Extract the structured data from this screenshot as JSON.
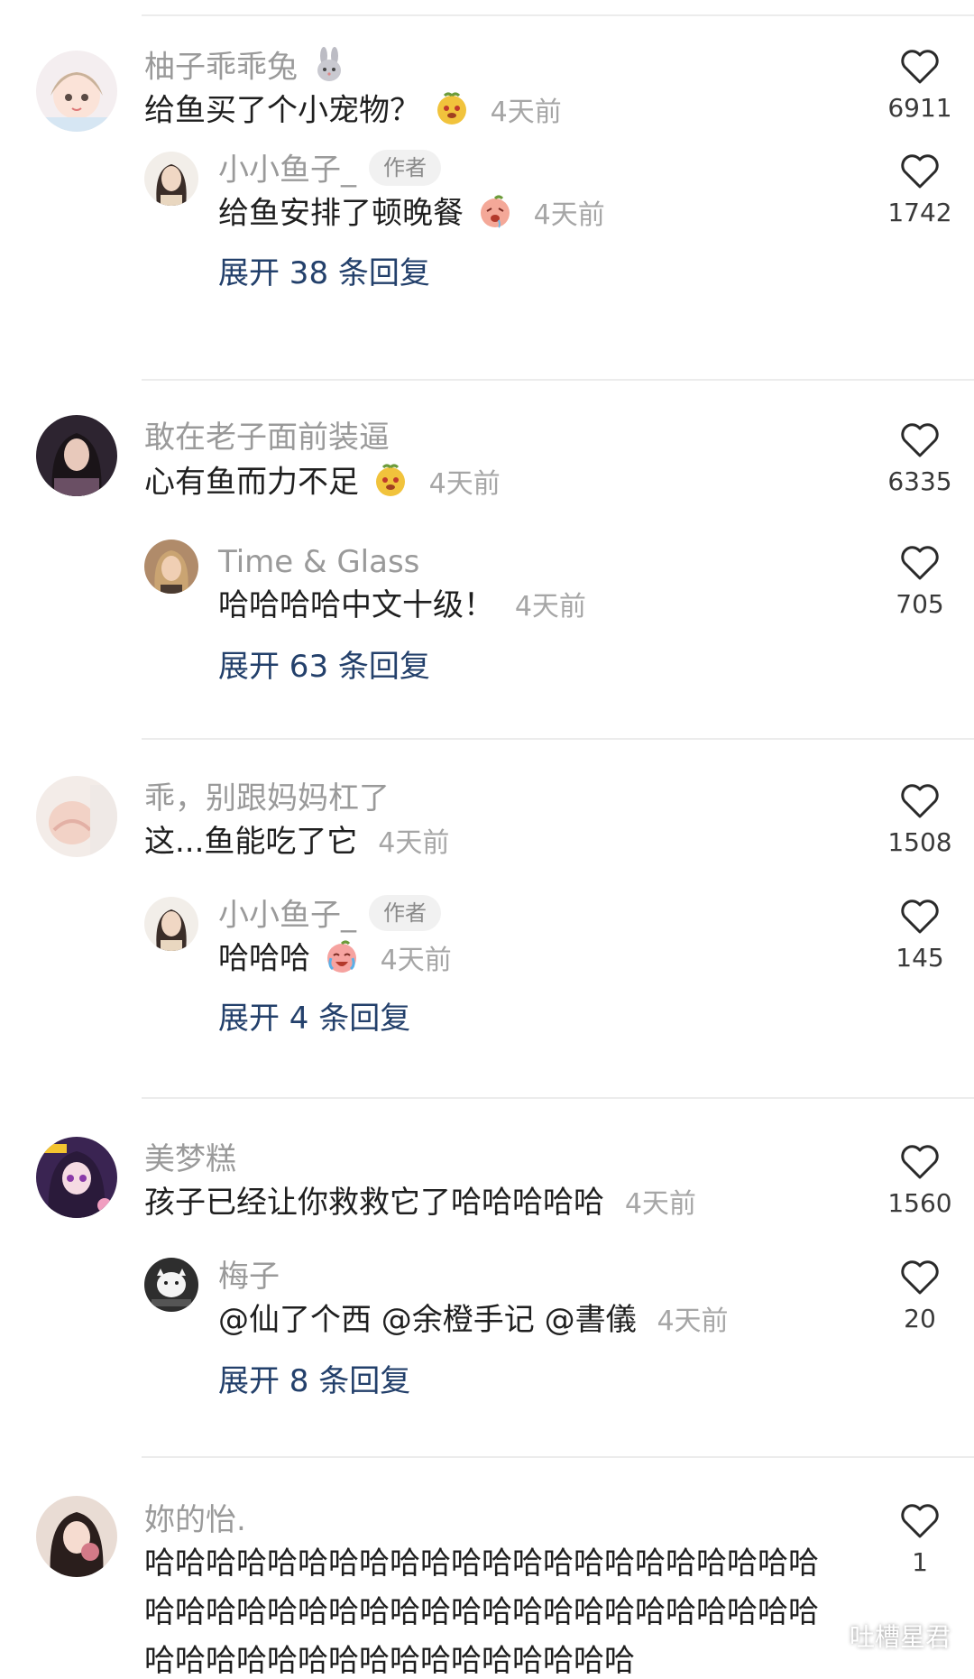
{
  "threads": [
    {
      "comment": {
        "username": "柚子乖乖兔",
        "text": "给鱼买了个小宠物？",
        "time": "4天前",
        "likes": "6911",
        "emoji_icon": "bunny-emoji",
        "text_emoji_icon": "bear-face-emoji"
      },
      "reply": {
        "username": "小小鱼子_",
        "badge": "作者",
        "text": "给鱼安排了顿晚餐",
        "time": "4天前",
        "likes": "1742",
        "text_emoji_icon": "drooling-peach-emoji"
      },
      "expand": "展开 38 条回复"
    },
    {
      "comment": {
        "username": "敢在老子面前装逼",
        "text": "心有鱼而力不足",
        "time": "4天前",
        "likes": "6335",
        "text_emoji_icon": "bear-face-emoji"
      },
      "reply": {
        "username": "Time & Glass",
        "text": "哈哈哈哈中文十级！",
        "time": "4天前",
        "likes": "705"
      },
      "expand": "展开 63 条回复"
    },
    {
      "comment": {
        "username": "乖，别跟妈妈杠了",
        "text": "这...鱼能吃了它",
        "time": "4天前",
        "likes": "1508"
      },
      "reply": {
        "username": "小小鱼子_",
        "badge": "作者",
        "text": "哈哈哈",
        "time": "4天前",
        "likes": "145",
        "text_emoji_icon": "crying-laughing-peach-emoji"
      },
      "expand": "展开 4 条回复"
    },
    {
      "comment": {
        "username": "美梦糕",
        "text": "孩子已经让你救救它了哈哈哈哈哈",
        "time": "4天前",
        "likes": "1560"
      },
      "reply": {
        "username": "梅子",
        "text": "@仙了个西 @余橙手记 @書儀",
        "time": "4天前",
        "likes": "20"
      },
      "expand": "展开 8 条回复"
    },
    {
      "comment": {
        "username": "妳的怡.",
        "text": "哈哈哈哈哈哈哈哈哈哈哈哈哈哈哈哈哈哈哈哈哈哈哈哈哈哈哈哈哈哈哈哈哈哈哈哈哈哈哈哈哈哈哈哈哈哈哈哈哈哈哈哈哈哈哈哈哈哈哈哈",
        "likes": "1"
      }
    }
  ],
  "watermark": {
    "text": "吐槽星君",
    "icon": "wechat-icon"
  },
  "colors": {
    "username": "#9a9a9a",
    "text": "#1f1f1f",
    "time": "#a6a6a6",
    "expand": "#23406b",
    "divider": "#ececec"
  }
}
